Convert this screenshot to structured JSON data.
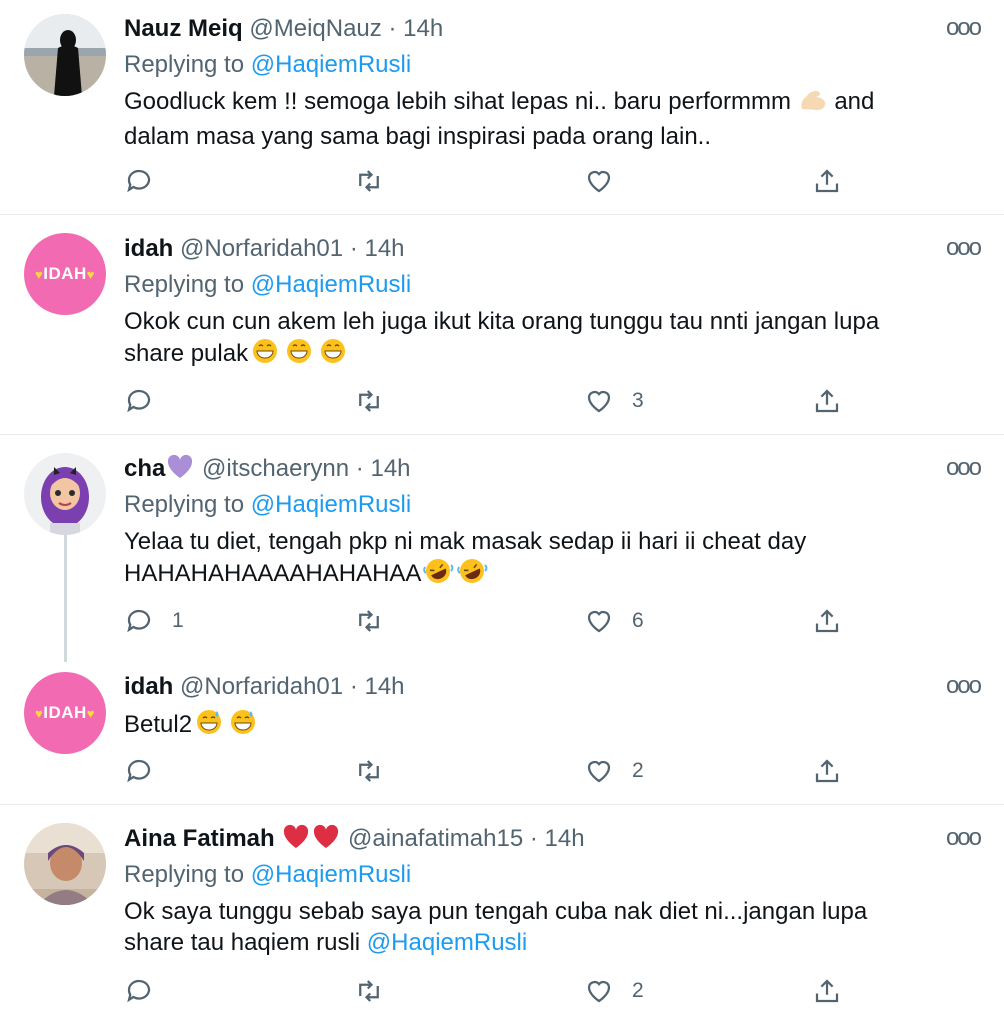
{
  "tweets": [
    {
      "name": "Nauz Meiq",
      "handle": "@MeiqNauz",
      "time": "14h",
      "replying_prefix": "Replying to",
      "replying_to": "@HaqiemRusli",
      "text": "Goodluck kem !! semoga lebih sihat lepas ni.. baru performmm",
      "text2": "and",
      "text3": "dalam masa yang sama bagi inspirasi pada orang lain..",
      "reply_count": "",
      "retweet_count": "",
      "like_count": ""
    },
    {
      "name": "idah",
      "handle": "@Norfaridah01",
      "time": "14h",
      "avatar_text": "IDAH",
      "replying_prefix": "Replying to",
      "replying_to": "@HaqiemRusli",
      "text": "Okok cun cun akem leh juga ikut kita orang tunggu tau nnti jangan lupa",
      "text2": "share pulak",
      "reply_count": "",
      "retweet_count": "",
      "like_count": "3"
    },
    {
      "name": "cha",
      "handle": "@itschaerynn",
      "time": "14h",
      "replying_prefix": "Replying to",
      "replying_to": "@HaqiemRusli",
      "text": "Yelaa tu diet, tengah pkp ni mak masak sedap ii hari ii cheat day",
      "text2": "HAHAHAHAAAAHAHAHAA",
      "reply_count": "1",
      "retweet_count": "",
      "like_count": "6"
    },
    {
      "name": "idah",
      "handle": "@Norfaridah01",
      "time": "14h",
      "avatar_text": "IDAH",
      "text": "Betul2",
      "reply_count": "",
      "retweet_count": "",
      "like_count": "2"
    },
    {
      "name": "Aina Fatimah",
      "handle": "@ainafatimah15",
      "time": "14h",
      "replying_prefix": "Replying to",
      "replying_to": "@HaqiemRusli",
      "text": "Ok saya tunggu sebab saya pun tengah cuba nak diet ni...jangan lupa",
      "text2": "share tau haqiem rusli",
      "mention": "@HaqiemRusli",
      "reply_count": "",
      "retweet_count": "",
      "like_count": "2"
    }
  ],
  "separator": "·",
  "more_icon": "more-dots-icon",
  "colors": {
    "link": "#1d9bf0",
    "muted": "#536471",
    "text": "#0f1419",
    "idah_avatar": "#f26bb2"
  }
}
